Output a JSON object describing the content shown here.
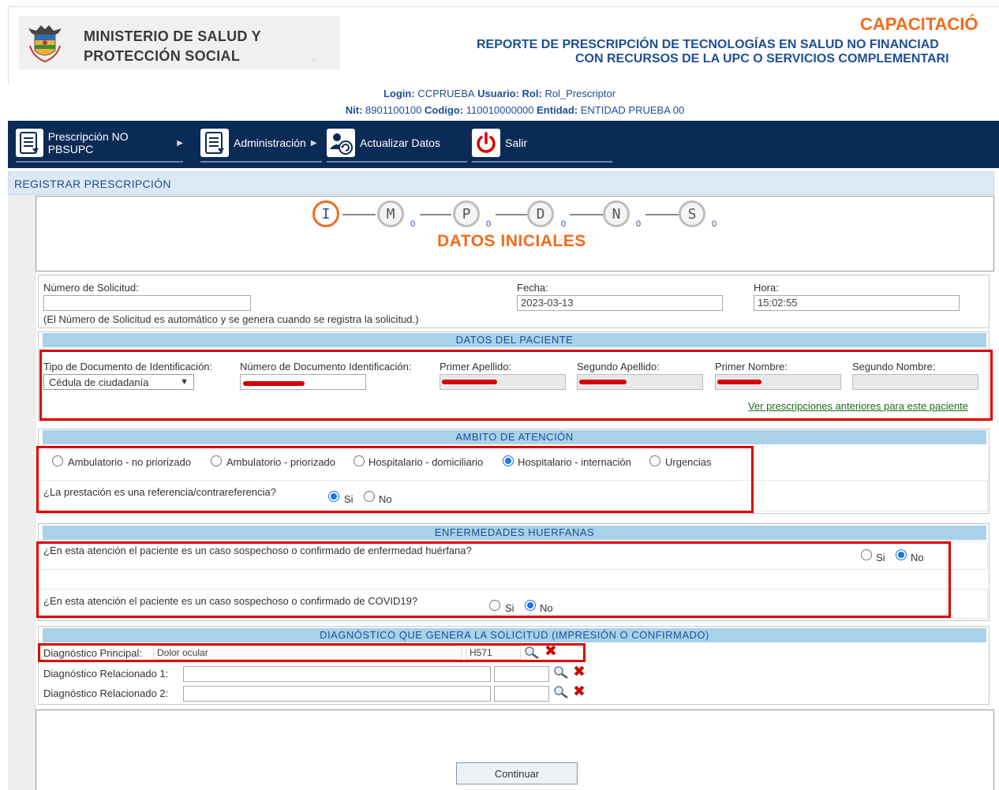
{
  "header": {
    "ministry_line1": "MINISTERIO DE SALUD Y",
    "ministry_line2": "PROTECCIÓN SOCIAL",
    "env_label": "CAPACITACIÓ",
    "report_title_line1": "REPORTE DE PRESCRIPCIÓN DE TECNOLOGÍAS EN SALUD NO FINANCIAD",
    "report_title_line2": "CON RECURSOS DE LA UPC O SERVICIOS COMPLEMENTARI"
  },
  "session": {
    "login_label": "Login:",
    "login_value": "CCPRUEBA",
    "usuario_label": "Usuario:",
    "rol_label": "Rol:",
    "rol_value": "Rol_Prescriptor",
    "nit_label": "Nit:",
    "nit_value": "8901100100",
    "codigo_label": "Codigo:",
    "codigo_value": "110010000000",
    "entidad_label": "Entidad:",
    "entidad_value": "ENTIDAD PRUEBA 00"
  },
  "nav": {
    "items": [
      {
        "label": "Prescripción NO PBSUPC",
        "icon": "document-list-icon"
      },
      {
        "label": "Administración",
        "icon": "document-list-icon"
      },
      {
        "label": "Actualizar Datos",
        "icon": "user-refresh-icon"
      },
      {
        "label": "Salir",
        "icon": "power-icon"
      }
    ]
  },
  "section_title": "REGISTRAR PRESCRIPCIÓN",
  "steps": {
    "items": [
      {
        "letter": "I",
        "count": ""
      },
      {
        "letter": "M",
        "count": "0"
      },
      {
        "letter": "P",
        "count": "0"
      },
      {
        "letter": "D",
        "count": "0"
      },
      {
        "letter": "N",
        "count": "0"
      },
      {
        "letter": "S",
        "count": "0"
      }
    ],
    "title": "DATOS INICIALES"
  },
  "solicitud": {
    "numero_label": "Número de Solicitud:",
    "numero_value": "",
    "fecha_label": "Fecha:",
    "fecha_value": "2023-03-13",
    "hora_label": "Hora:",
    "hora_value": "15:02:55",
    "note": "(El Número de Solicitud es automático y se genera cuando se registra la solicitud.)"
  },
  "paciente": {
    "section": "DATOS DEL PACIENTE",
    "tipo_doc_label": "Tipo de Documento de Identificación:",
    "tipo_doc_value": "Cédula de ciudadanía",
    "num_doc_label": "Número de Documento Identificación:",
    "primer_apellido_label": "Primer Apellido:",
    "segundo_apellido_label": "Segundo Apellido:",
    "primer_nombre_label": "Primer Nombre:",
    "segundo_nombre_label": "Segundo Nombre:",
    "segundo_nombre_value": "",
    "ver_link": "Ver prescripciones anteriores para este paciente"
  },
  "ambito": {
    "section": "AMBITO DE ATENCIÓN",
    "options": [
      {
        "label": "Ambulatorio - no priorizado",
        "selected": false
      },
      {
        "label": "Ambulatorio - priorizado",
        "selected": false
      },
      {
        "label": "Hospitalario - domiciliario",
        "selected": false
      },
      {
        "label": "Hospitalario - internación",
        "selected": true
      },
      {
        "label": "Urgencias",
        "selected": false
      }
    ],
    "referencia_question": "¿La prestación es una referencia/contrareferencia?",
    "si_label": "Si",
    "no_label": "No",
    "referencia_value": "Si"
  },
  "huerfanas": {
    "section": "ENFERMEDADES HUERFANAS",
    "q1": "¿En esta atención el paciente es un caso sospechoso o confirmado de enfermedad huérfana?",
    "q1_value": "No",
    "q2": "¿En esta atención el paciente es un caso sospechoso o confirmado de COVID19?",
    "q2_value": "No",
    "si_label": "Si",
    "no_label": "No"
  },
  "diagnostico": {
    "section": "DIAGNÓSTICO QUE GENERA LA SOLICITUD (IMPRESIÓN O CONFIRMADO)",
    "principal_label": "Diagnóstico Principal:",
    "principal_desc": "Dolor ocular",
    "principal_code": "H571",
    "rel1_label": "Diagnóstico Relacionado 1:",
    "rel1_desc": "",
    "rel1_code": "",
    "rel2_label": "Diagnóstico Relacionado 2:",
    "rel2_desc": "",
    "rel2_code": ""
  },
  "actions": {
    "continuar": "Continuar"
  },
  "colors": {
    "brand_blue": "#1f4e96",
    "nav_bg": "#0b2b57",
    "accent_orange": "#f26c1c",
    "highlight_red": "#e00000",
    "section_header": "#a9d1ea"
  }
}
